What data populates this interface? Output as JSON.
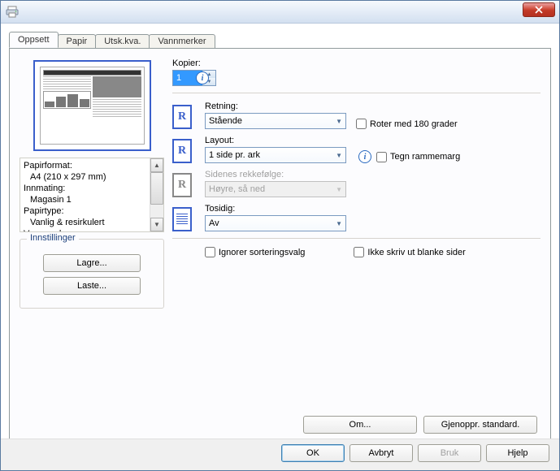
{
  "tabs": [
    "Oppsett",
    "Papir",
    "Utsk.kva.",
    "Vannmerker"
  ],
  "active_tab": 0,
  "copies": {
    "label": "Kopier:",
    "value": "1"
  },
  "info_panel": {
    "items": [
      {
        "label": "Papirformat:",
        "value": "A4 (210 x 297 mm)"
      },
      {
        "label": "Innmating:",
        "value": "Magasin 1"
      },
      {
        "label": "Papirtype:",
        "value": "Vanlig & resirkulert"
      },
      {
        "label": "Vannmerke:",
        "value": ""
      }
    ]
  },
  "settings_group": {
    "title": "Innstillinger",
    "save": "Lagre...",
    "load": "Laste..."
  },
  "orientation": {
    "label": "Retning:",
    "value": "Stående",
    "rotate_label": "Roter med 180 grader"
  },
  "layout": {
    "label": "Layout:",
    "value": "1 side pr. ark",
    "frame_label": "Tegn rammemarg"
  },
  "page_order": {
    "label": "Sidenes rekkefølge:",
    "value": "Høyre, så ned"
  },
  "duplex": {
    "label": "Tosidig:",
    "value": "Av"
  },
  "ignore_collate": "Ignorer sorteringsvalg",
  "skip_blank": "Ikke skriv ut blanke sider",
  "about_btn": "Om...",
  "restore_btn": "Gjenoppr. standard.",
  "footer": {
    "ok": "OK",
    "cancel": "Avbryt",
    "apply": "Bruk",
    "help": "Hjelp"
  }
}
